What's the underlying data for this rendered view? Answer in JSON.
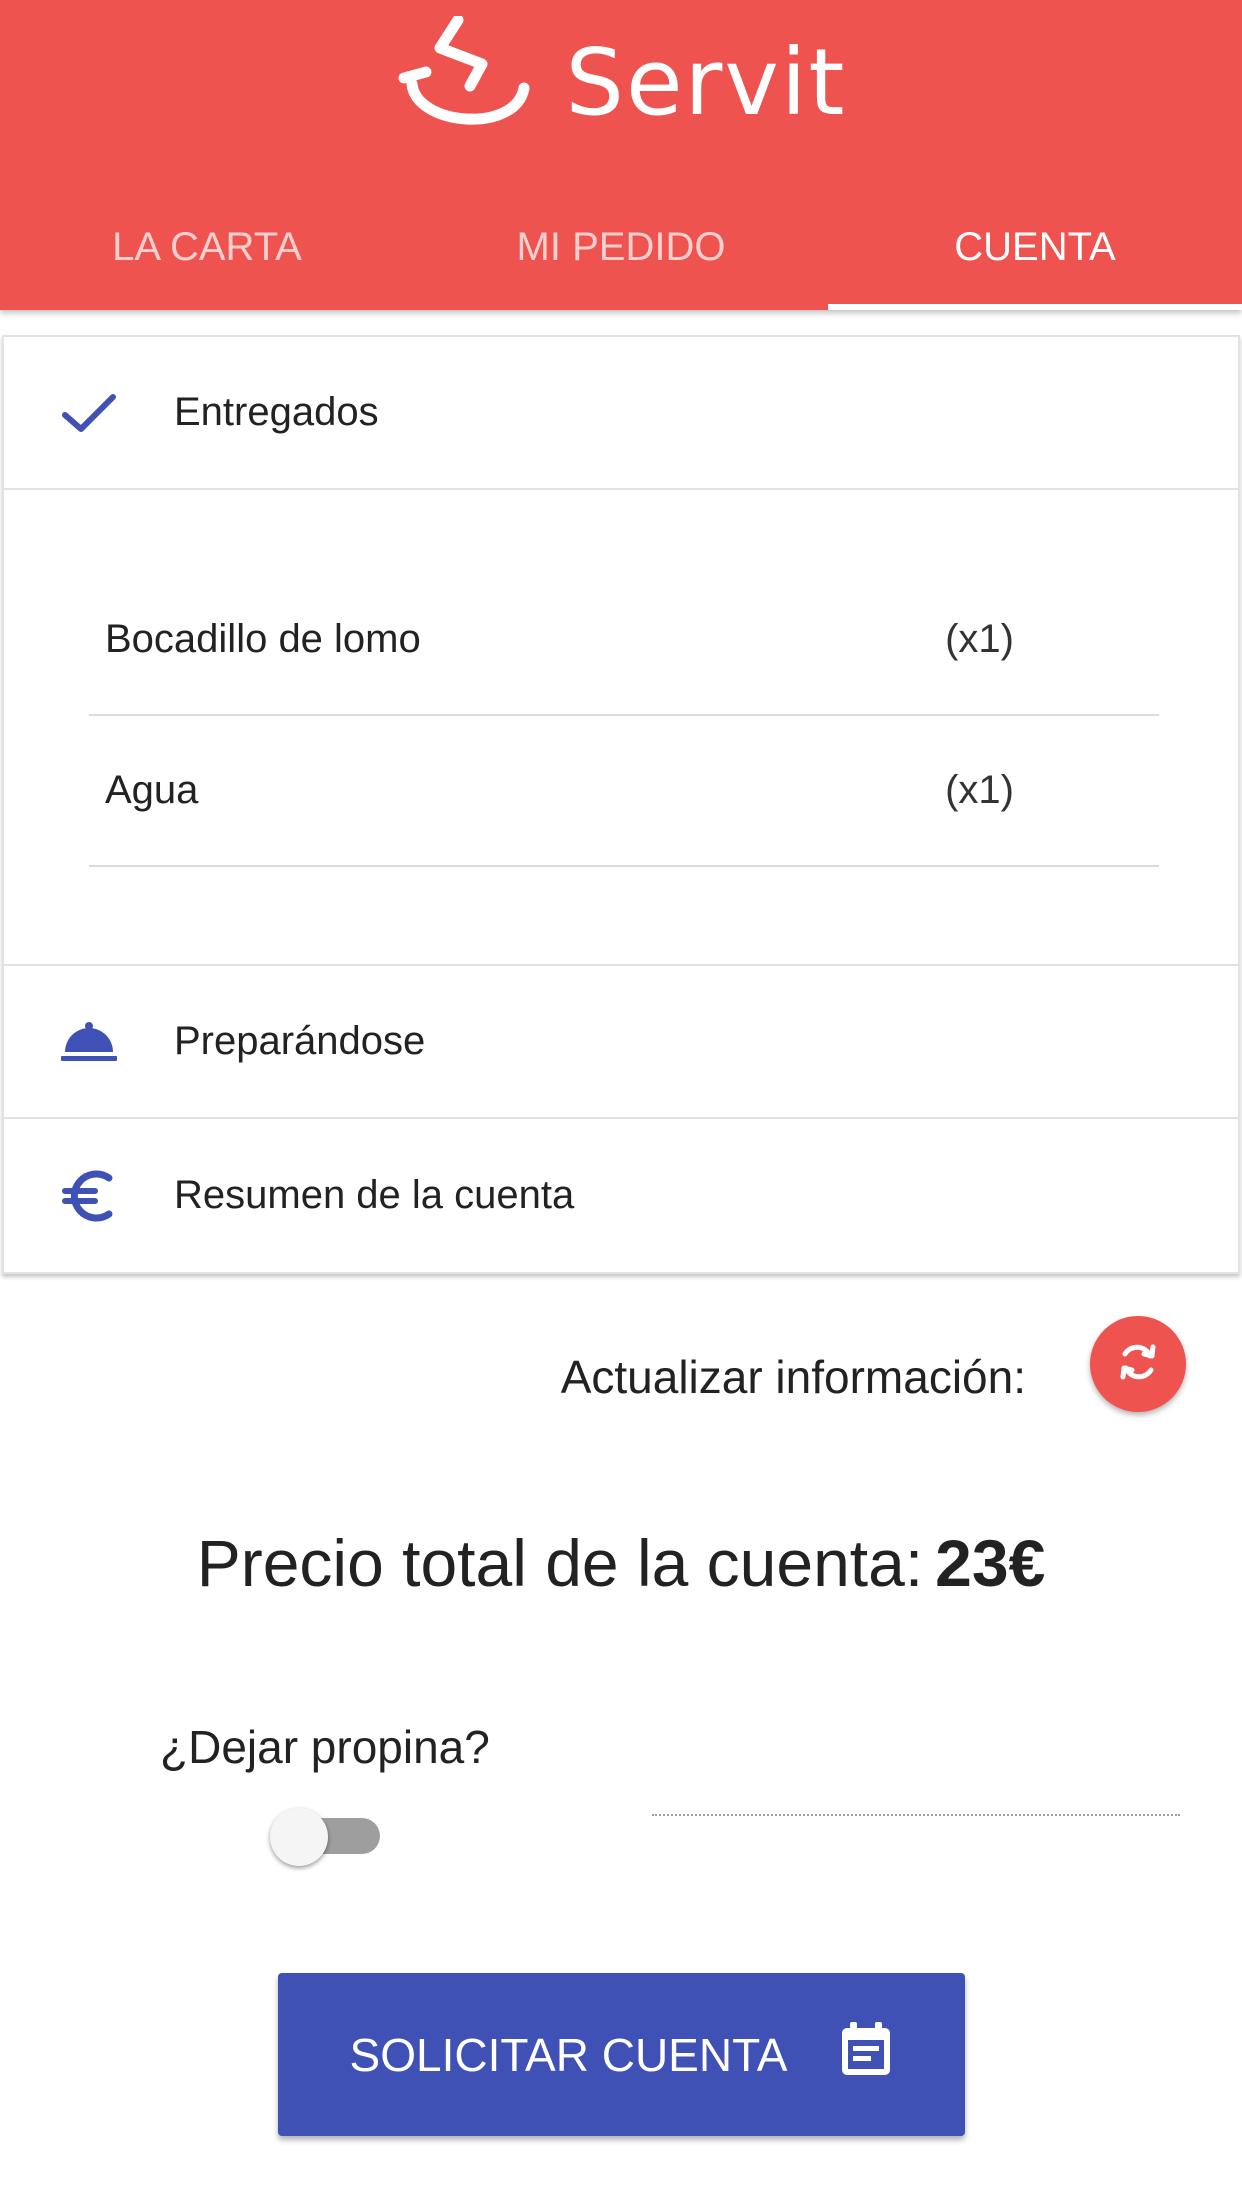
{
  "app": {
    "name": "Servit"
  },
  "tabs": [
    {
      "label": "LA CARTA",
      "active": false
    },
    {
      "label": "MI PEDIDO",
      "active": false
    },
    {
      "label": "CUENTA",
      "active": true
    }
  ],
  "sections": {
    "delivered": {
      "label": "Entregados",
      "icon": "check-icon",
      "items": [
        {
          "name": "Bocadillo de lomo",
          "qty": "(x1)"
        },
        {
          "name": "Agua",
          "qty": "(x1)"
        }
      ]
    },
    "preparing": {
      "label": "Preparándose",
      "icon": "cloche-icon"
    },
    "summary": {
      "label": "Resumen de la cuenta",
      "icon": "euro-icon"
    }
  },
  "refresh": {
    "label": "Actualizar información:",
    "icon": "refresh-icon"
  },
  "total": {
    "label": "Precio total de la cuenta:",
    "value": "23€"
  },
  "tip": {
    "label": "¿Dejar propina?",
    "enabled": false,
    "input_value": ""
  },
  "request_button": {
    "label": "SOLICITAR CUENTA",
    "icon": "calendar-icon"
  },
  "colors": {
    "primary": "#ef5350",
    "accent": "#3f51b5",
    "text": "#222222"
  }
}
